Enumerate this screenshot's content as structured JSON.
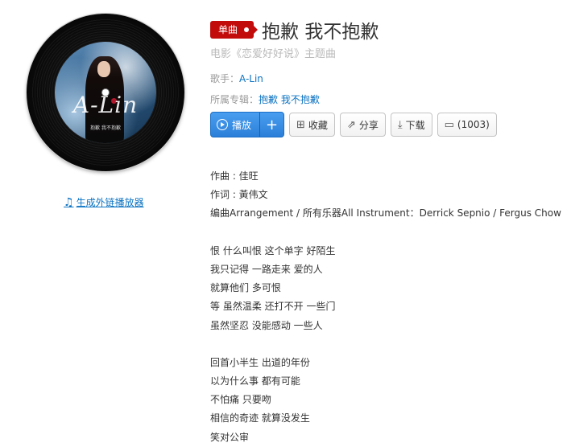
{
  "disc": {
    "cover_art_text": "A-Lin",
    "cover_art_subtext": "抱歉 我不抱歉"
  },
  "outchain": {
    "icon": "music-note-icon",
    "label": "生成外链播放器"
  },
  "song": {
    "badge": "单曲",
    "title": "抱歉 我不抱歉",
    "subtitle": "电影《恋爱好好说》主题曲",
    "artist_label": "歌手：",
    "artist": "A-Lin",
    "album_label": "所属专辑：",
    "album": "抱歉 我不抱歉"
  },
  "actions": {
    "play": "播放",
    "add": "+",
    "favorite": "收藏",
    "share": "分享",
    "download": "下载",
    "comments": "(1003)"
  },
  "lyrics": {
    "credits": [
      "作曲 : 佳旺",
      "作词 : 黃伟文",
      "编曲Arrangement / 所有乐器All Instrument：Derrick Sepnio / Fergus Chow"
    ],
    "verse1": [
      "恨 什么叫恨 这个单字 好陌生",
      "我只记得 一路走来 爱的人",
      "就算他们 多可恨",
      "等 虽然温柔 还打不开 一些门",
      "虽然坚忍 没能感动 一些人"
    ],
    "verse2": [
      "回首小半生 出道的年份",
      "以为什么事 都有可能",
      "不怕痛 只要吻",
      "相信的奇迹 就算没发生",
      "笑对公审"
    ]
  },
  "colors": {
    "brand_red": "#c20c0c",
    "link_blue": "#0c73c2",
    "play_blue": "#2b7fd8"
  }
}
